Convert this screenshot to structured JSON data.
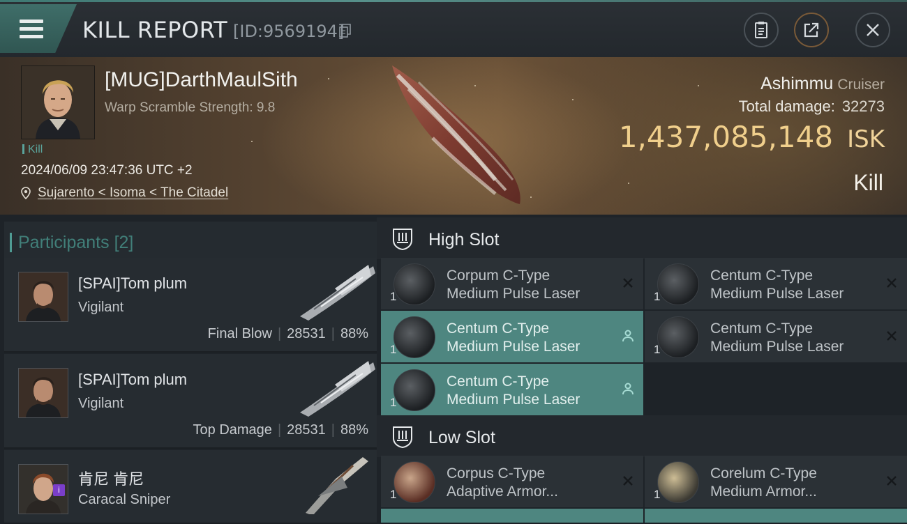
{
  "header": {
    "title": "KILL REPORT",
    "report_id": "[ID:9569194]",
    "icons": [
      "menu-icon",
      "copy-icon",
      "clipboard-icon",
      "share-icon",
      "close-icon"
    ]
  },
  "victim": {
    "name": "[MUG]DarthMaulSith",
    "scram": "Warp Scramble Strength: 9.8",
    "tag": "Kill",
    "datetime": "2024/06/09 23:47:36 UTC +2",
    "location": "Sujarento < Isoma < The Citadel",
    "ship": "Ashimmu",
    "ship_class": "Cruiser",
    "total_damage_label": "Total damage:",
    "total_damage": "32273",
    "isk_value": "1,437,085,148",
    "isk_unit": "ISK",
    "result": "Kill"
  },
  "participants": {
    "label": "Participants",
    "count": "[2]",
    "rows": [
      {
        "name": "[SPAI]Tom plum",
        "ship": "Vigilant",
        "role": "Final Blow",
        "damage": "28531",
        "percent": "88%"
      },
      {
        "name": "[SPAI]Tom plum",
        "ship": "Vigilant",
        "role": "Top Damage",
        "damage": "28531",
        "percent": "88%"
      },
      {
        "name": "肯尼 肯尼",
        "ship": "Caracal Sniper",
        "role": "",
        "damage": "",
        "percent": ""
      }
    ]
  },
  "slots": {
    "high": {
      "label": "High Slot",
      "modules": [
        {
          "line1": "Corpum C-Type",
          "line2": "Medium Pulse Laser",
          "qty": "1",
          "state": "destroyed"
        },
        {
          "line1": "Centum C-Type",
          "line2": "Medium Pulse Laser",
          "qty": "1",
          "state": "destroyed"
        },
        {
          "line1": "Centum C-Type",
          "line2": "Medium Pulse Laser",
          "qty": "1",
          "state": "dropped"
        },
        {
          "line1": "Centum C-Type",
          "line2": "Medium Pulse Laser",
          "qty": "1",
          "state": "destroyed"
        },
        {
          "line1": "Centum C-Type",
          "line2": "Medium Pulse Laser",
          "qty": "1",
          "state": "dropped"
        }
      ]
    },
    "low": {
      "label": "Low Slot",
      "modules": [
        {
          "line1": "Corpus C-Type",
          "line2": "Adaptive Armor...",
          "qty": "1",
          "state": "destroyed"
        },
        {
          "line1": "Corelum C-Type",
          "line2": "Medium Armor...",
          "qty": "1",
          "state": "destroyed"
        }
      ]
    }
  },
  "colors": {
    "accent": "#4e8680",
    "isk": "#f0cf8c",
    "participants_label": "#417f79"
  }
}
